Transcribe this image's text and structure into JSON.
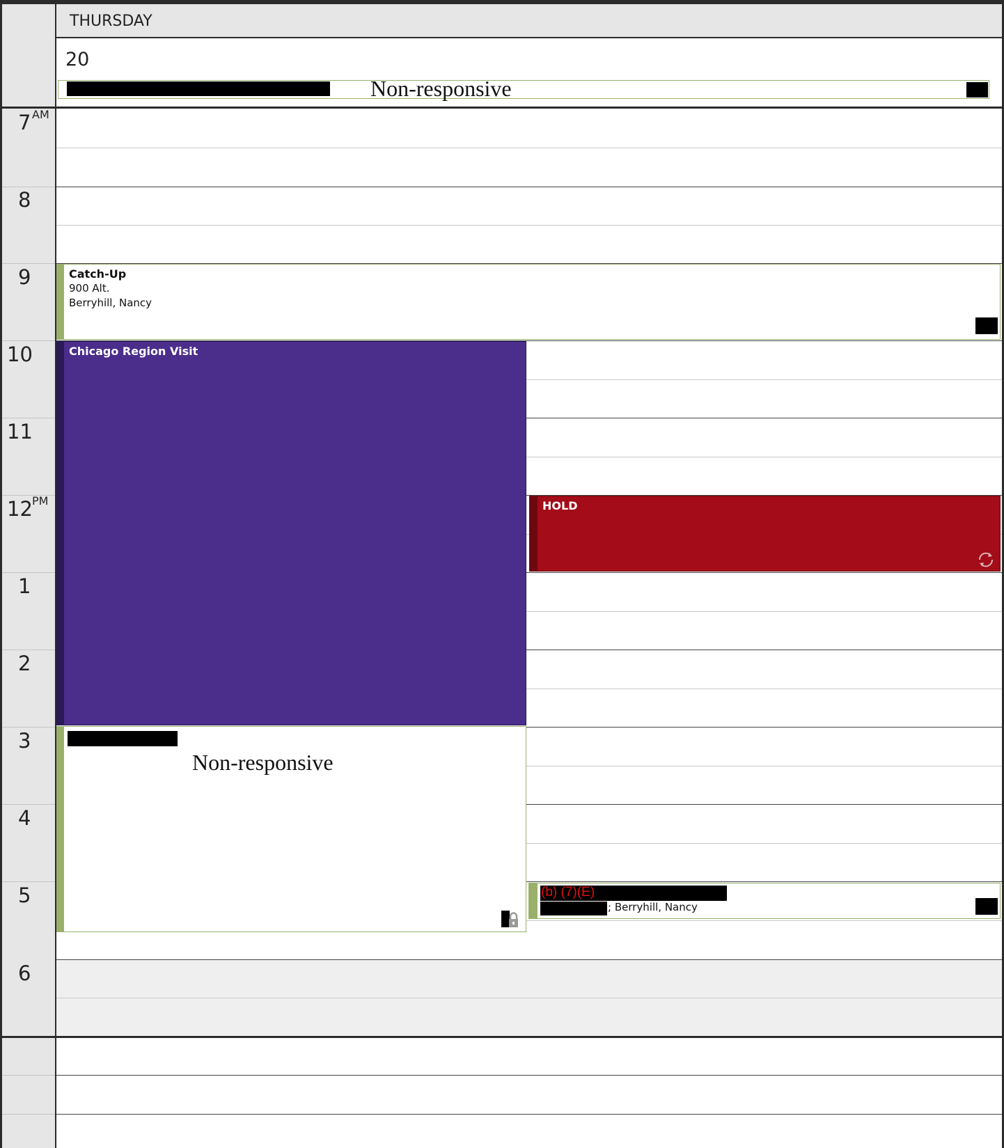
{
  "day": {
    "name": "THURSDAY",
    "date": "20"
  },
  "all_day": {
    "text": "Non-responsive"
  },
  "hours": [
    {
      "num": "7",
      "ampm": "AM"
    },
    {
      "num": "8",
      "ampm": ""
    },
    {
      "num": "9",
      "ampm": ""
    },
    {
      "num": "10",
      "ampm": ""
    },
    {
      "num": "11",
      "ampm": ""
    },
    {
      "num": "12",
      "ampm": "PM"
    },
    {
      "num": "1",
      "ampm": ""
    },
    {
      "num": "2",
      "ampm": ""
    },
    {
      "num": "3",
      "ampm": ""
    },
    {
      "num": "4",
      "ampm": ""
    },
    {
      "num": "5",
      "ampm": ""
    },
    {
      "num": "6",
      "ampm": ""
    }
  ],
  "events": {
    "catchup": {
      "title": "Catch-Up",
      "location": "900 Alt.",
      "organizer": "Berryhill, Nancy"
    },
    "chicago": {
      "title": "Chicago Region Visit"
    },
    "hold": {
      "title": "HOLD"
    },
    "afternoon": {
      "text": "Non-responsive"
    },
    "evening": {
      "redaction_code": "(b) (7)(E)",
      "organizer_suffix": "; Berryhill, Nancy"
    }
  },
  "colors": {
    "chicago_bg": "#4b2d8b",
    "chicago_accent": "#2a1b57",
    "hold_bg": "#a30c18",
    "hold_accent": "#6e0810",
    "event_accent_green": "#9ab06a",
    "redaction_code": "#e01010"
  },
  "icons": [
    "recurring-icon",
    "private-lock-icon"
  ]
}
